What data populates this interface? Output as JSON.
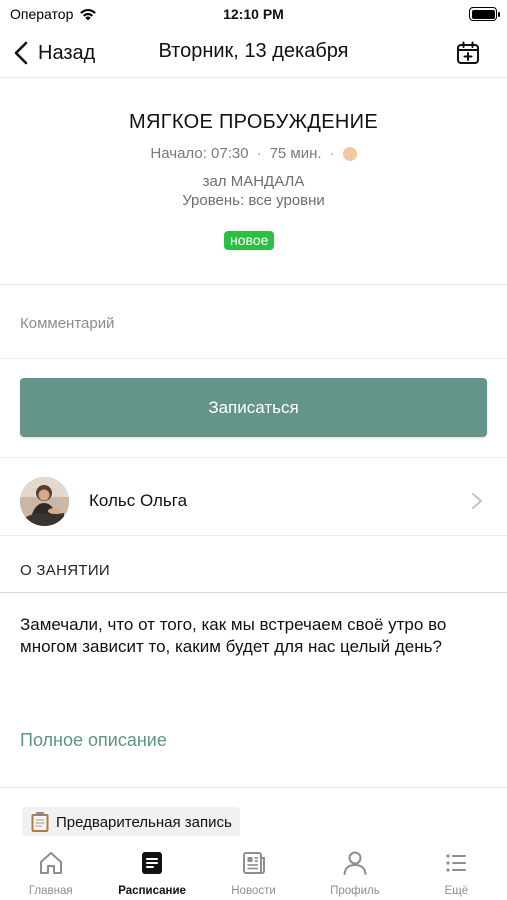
{
  "status_bar": {
    "carrier": "Оператор",
    "time": "12:10 PM"
  },
  "nav": {
    "back_label": "Назад",
    "title": "Вторник, 13 декабря"
  },
  "class": {
    "title": "МЯГКОЕ ПРОБУЖДЕНИЕ",
    "start": "Начало: 07:30",
    "duration": "75 мин.",
    "separator": "·",
    "hall": "зал МАНДАЛА",
    "level": "Уровень: все уровни",
    "badge": "новое",
    "intensity_color": "#f0c9a2",
    "badge_color": "#2fbe44"
  },
  "comment": {
    "placeholder": "Комментарий",
    "value": ""
  },
  "signup": {
    "label": "Записаться",
    "color": "#65958a"
  },
  "instructor": {
    "name": "Кольс Ольга"
  },
  "about": {
    "header": "О ЗАНЯТИИ",
    "text": "Замечали, что от того, как мы встречаем  своё утро во многом зависит то, каким будет для нас целый день?",
    "full_link": "Полное описание",
    "link_color": "#5c9487"
  },
  "prebook": {
    "label": "Предварительная запись"
  },
  "tabs": [
    {
      "label": "Главная",
      "icon": "home-icon",
      "active": false
    },
    {
      "label": "Расписание",
      "icon": "schedule-icon",
      "active": true
    },
    {
      "label": "Новости",
      "icon": "news-icon",
      "active": false
    },
    {
      "label": "Профиль",
      "icon": "profile-icon",
      "active": false
    },
    {
      "label": "Ещё",
      "icon": "more-icon",
      "active": false
    }
  ]
}
